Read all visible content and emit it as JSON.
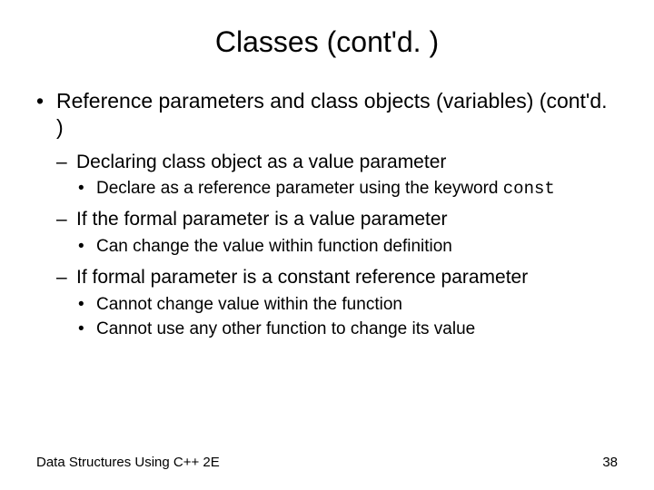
{
  "title": "Classes (cont'd. )",
  "bullets": {
    "l1": "Reference parameters and class objects (variables) (cont'd. )",
    "l2a": "Declaring class object as a value parameter",
    "l3a_prefix": "Declare as a reference parameter using the keyword ",
    "l3a_code": "const",
    "l2b": "If the formal parameter is a value parameter",
    "l3b": "Can change the value within function definition",
    "l2c": "If formal parameter is a constant reference parameter",
    "l3c1": "Cannot change value within the function",
    "l3c2": "Cannot use any other function to change its value"
  },
  "footer": {
    "left": "Data Structures Using C++ 2E",
    "right": "38"
  }
}
